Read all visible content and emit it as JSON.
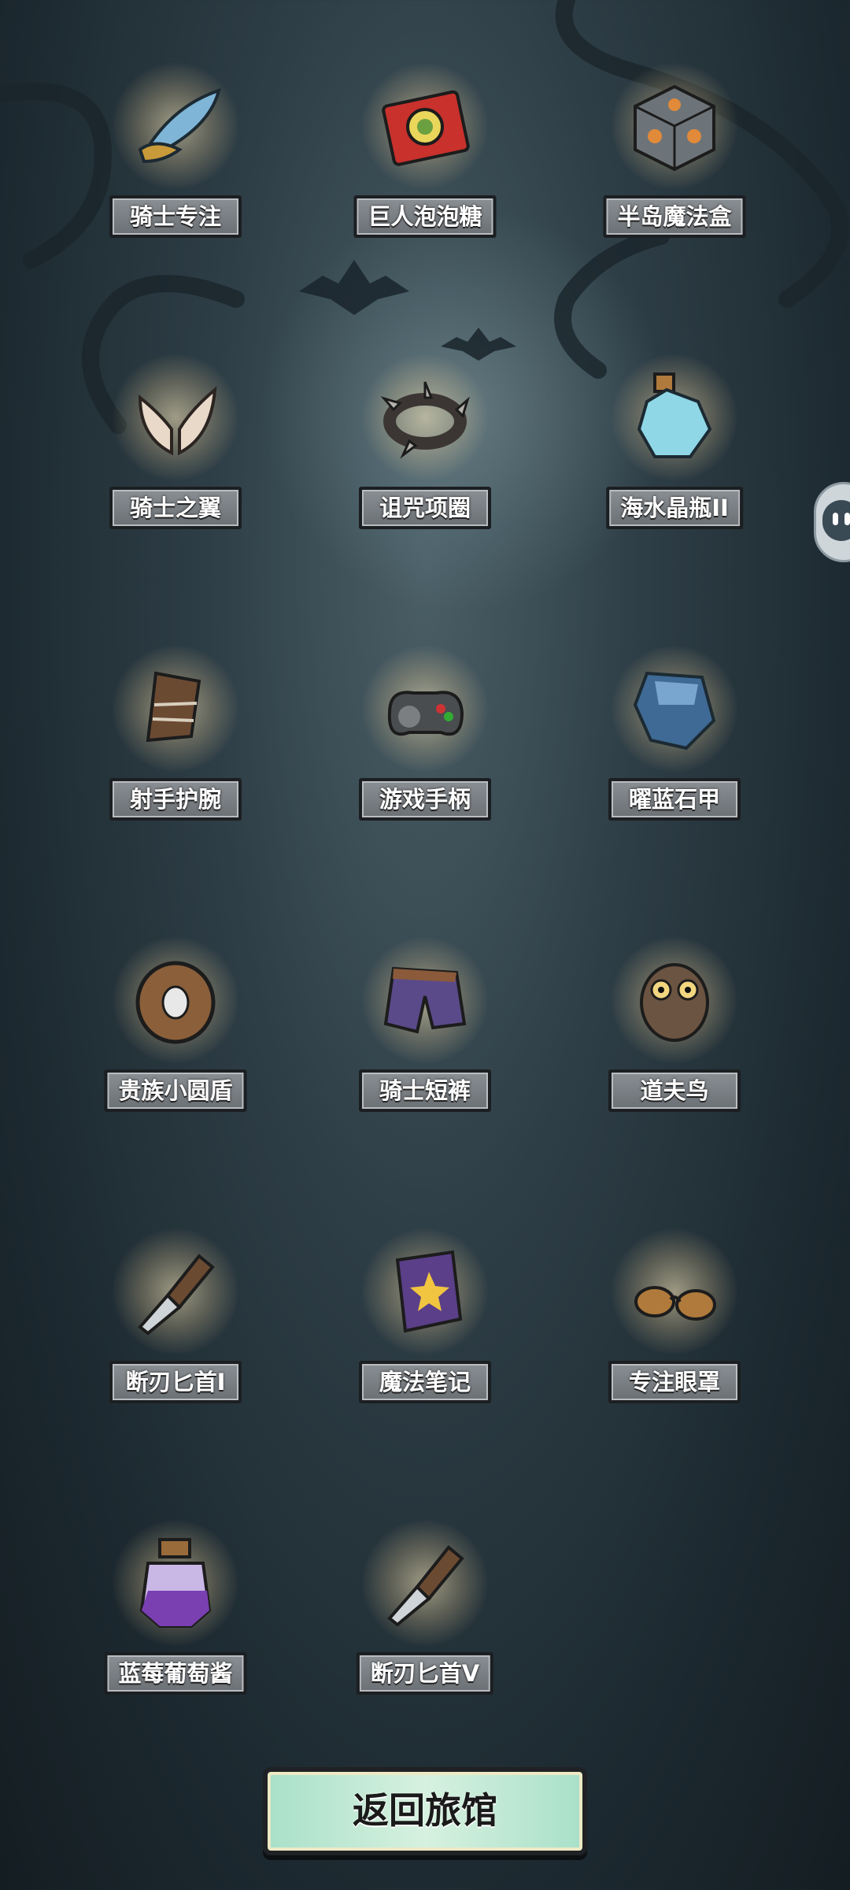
{
  "items": [
    {
      "label": "骑士专注",
      "icon": "feather-brooch-icon"
    },
    {
      "label": "巨人泡泡糖",
      "icon": "bubblegum-pack-icon"
    },
    {
      "label": "半岛魔法盒",
      "icon": "magic-cube-icon"
    },
    {
      "label": "骑士之翼",
      "icon": "wings-icon"
    },
    {
      "label": "诅咒项圈",
      "icon": "spiked-collar-icon"
    },
    {
      "label": "海水晶瓶II",
      "icon": "crystal-bottle-icon"
    },
    {
      "label": "射手护腕",
      "icon": "bracer-icon"
    },
    {
      "label": "游戏手柄",
      "icon": "gamepad-icon"
    },
    {
      "label": "曜蓝石甲",
      "icon": "blue-armor-icon"
    },
    {
      "label": "贵族小圆盾",
      "icon": "round-shield-icon"
    },
    {
      "label": "骑士短裤",
      "icon": "knight-shorts-icon"
    },
    {
      "label": "道夫鸟",
      "icon": "owl-icon"
    },
    {
      "label": "断刃匕首I",
      "icon": "broken-dagger-icon"
    },
    {
      "label": "魔法笔记",
      "icon": "magic-book-icon"
    },
    {
      "label": "专注眼罩",
      "icon": "eye-mask-icon"
    },
    {
      "label": "蓝莓葡萄酱",
      "icon": "jam-jar-icon"
    },
    {
      "label": "断刃匕首V",
      "icon": "broken-dagger-icon"
    }
  ],
  "return_button": {
    "label": "返回旅馆"
  },
  "colors": {
    "label_bg": "#7a7f84",
    "button_bg": "#c2ead6",
    "background": "#2f3f47"
  }
}
